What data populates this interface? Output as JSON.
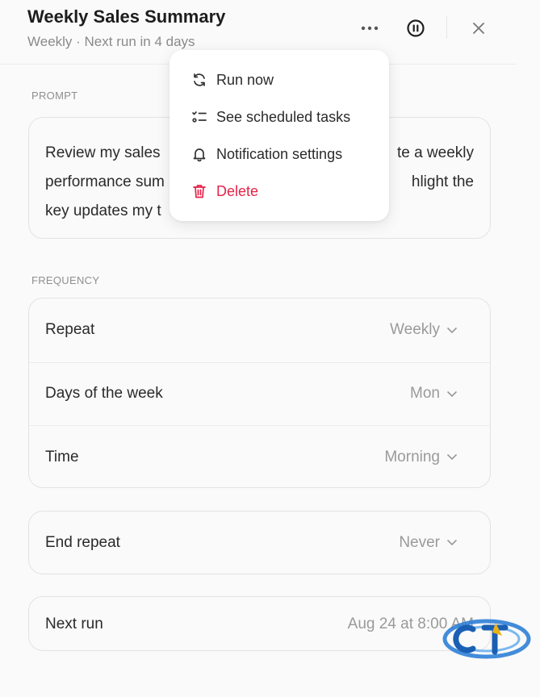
{
  "header": {
    "title": "Weekly Sales Summary",
    "subtitle": "Weekly · Next run in 4 days"
  },
  "icons": {
    "more": "more-horizontal-icon",
    "pause": "pause-circle-icon",
    "close": "close-icon"
  },
  "prompt": {
    "label": "PROMPT",
    "lines": [
      "Review my sales",
      "te a weekly",
      "performance sum",
      "hlight the",
      "key updates my t"
    ]
  },
  "frequency": {
    "label": "FREQUENCY",
    "rows": [
      {
        "label": "Repeat",
        "value": "Weekly"
      },
      {
        "label": "Days of the week",
        "value": "Mon"
      },
      {
        "label": "Time",
        "value": "Morning"
      }
    ]
  },
  "end_repeat": {
    "label": "End repeat",
    "value": "Never"
  },
  "next_run": {
    "label": "Next run",
    "value": "Aug 24 at 8:00 AM"
  },
  "menu": {
    "items": [
      {
        "label": "Run now",
        "icon": "refresh-icon"
      },
      {
        "label": "See scheduled tasks",
        "icon": "checklist-icon"
      },
      {
        "label": "Notification settings",
        "icon": "bell-icon"
      },
      {
        "label": "Delete",
        "icon": "trash-icon"
      }
    ]
  },
  "colors": {
    "danger": "#e5234a",
    "muted": "#9a9a9a"
  }
}
